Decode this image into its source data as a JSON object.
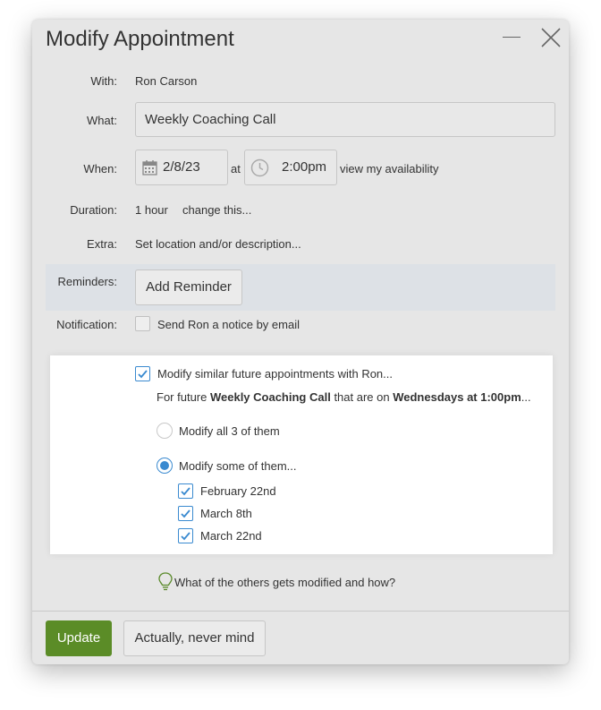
{
  "dialog": {
    "title": "Modify Appointment"
  },
  "form": {
    "with_label": "With:",
    "with_value": "Ron Carson",
    "what_label": "What:",
    "what_value": "Weekly Coaching Call",
    "when_label": "When:",
    "date_value": "2/8/23",
    "at_text": "at",
    "time_value": "2:00pm",
    "availability_link": "view my availability",
    "duration_label": "Duration:",
    "duration_value": "1 hour",
    "change_link": "change this...",
    "extra_label": "Extra:",
    "extra_link": "Set location and/or description...",
    "reminders_label": "Reminders:",
    "add_reminder_label": "Add Reminder",
    "notification_label": "Notification:",
    "notification_text": "Send Ron a notice by email",
    "notification_checked": false
  },
  "series": {
    "modify_similar_label": "Modify similar future appointments with Ron...",
    "modify_similar_checked": true,
    "future_prefix": "For future ",
    "future_name": "Weekly Coaching Call",
    "future_middle": " that are on ",
    "future_when": "Wednesdays at 1:00pm",
    "future_suffix": "...",
    "option_all_label": "Modify all 3 of them",
    "option_some_label": "Modify some of them...",
    "selected_option": "some",
    "dates": [
      {
        "label": "February 22nd",
        "checked": true
      },
      {
        "label": "March 8th",
        "checked": true
      },
      {
        "label": "March 22nd",
        "checked": true
      }
    ]
  },
  "help": {
    "text": "What of the others gets modified and how?"
  },
  "footer": {
    "update_label": "Update",
    "cancel_label": "Actually, never mind"
  },
  "colors": {
    "accent_green": "#5b8c27",
    "link_green": "#5a8a2a",
    "checkbox_blue": "#3a8ad0",
    "reminder_band": "#dde1e6"
  },
  "icons": {
    "calendar": "calendar-icon",
    "clock": "clock-icon",
    "lightbulb": "lightbulb-icon",
    "minimize": "minimize-icon",
    "close": "close-icon"
  }
}
